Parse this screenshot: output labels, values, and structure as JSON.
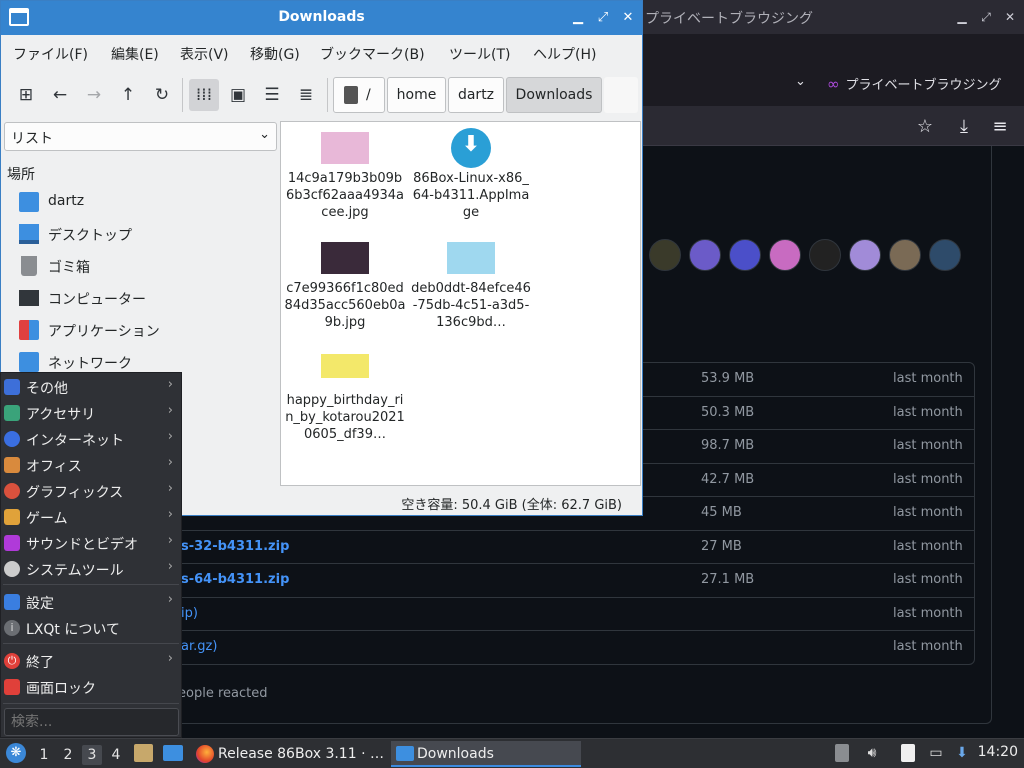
{
  "browser": {
    "title": "プライベートブラウジング",
    "private_tab_label": "プライベートブラウジング",
    "avatar_colors": [
      "#3a3a2a",
      "#6b5bc8",
      "#4b4fc9",
      "#c86bc1",
      "#222222",
      "#a18bd8",
      "#7a6a55",
      "#2e4b6a"
    ],
    "assets": [
      {
        "name": "",
        "size": "53.9 MB",
        "date": "last month"
      },
      {
        "name": "",
        "size": "50.3 MB",
        "date": "last month"
      },
      {
        "name": "",
        "size": "98.7 MB",
        "date": "last month"
      },
      {
        "name": "",
        "size": "42.7 MB",
        "date": "last month"
      },
      {
        "name": "",
        "size": "45 MB",
        "date": "last month"
      },
      {
        "name": "s-32-b4311.zip",
        "size": "27 MB",
        "date": "last month"
      },
      {
        "name": "s-64-b4311.zip",
        "size": "27.1 MB",
        "date": "last month"
      },
      {
        "name": "ip)",
        "size": "",
        "date": "last month"
      },
      {
        "name": "ar.gz)",
        "size": "",
        "date": "last month"
      }
    ],
    "reacted_text": "eople reacted"
  },
  "filemanager": {
    "title": "Downloads",
    "menu": [
      "ファイル(F)",
      "編集(E)",
      "表示(V)",
      "移動(G)",
      "ブックマーク(B)",
      "ツール(T)",
      "ヘルプ(H)"
    ],
    "breadcrumbs": [
      "/",
      "home",
      "dartz",
      "Downloads"
    ],
    "view_mode": "リスト",
    "places_heading": "場所",
    "places": [
      "dartz",
      "デスクトップ",
      "ゴミ箱",
      "コンピューター",
      "アプリケーション",
      "ネットワーク"
    ],
    "files": [
      {
        "name": "14c9a179b3b09b6b3cf62aaa4934acee.jpg",
        "thumb": "#e8b8d8"
      },
      {
        "name": "86Box-Linux-x86_64-b4311.AppImage",
        "thumb": "#2a9fd6"
      },
      {
        "name": "c7e99366f1c80ed84d35acc560eb0a9b.jpg",
        "thumb": "#3a2a3a"
      },
      {
        "name": "deb0ddt-84efce46-75db-4c51-a3d5-136c9bd…",
        "thumb": "#9fd8ef"
      },
      {
        "name": "happy_birthday_rin_by_kotarou20210605_df39…",
        "thumb": "#f3e86a"
      }
    ],
    "status": "空き容量: 50.4 GiB (全体: 62.7 GiB)"
  },
  "startmenu": {
    "categories": [
      {
        "label": "その他",
        "color": "#3d6fd9"
      },
      {
        "label": "アクセサリ",
        "color": "#3aa37a"
      },
      {
        "label": "インターネット",
        "color": "#3a6ee0"
      },
      {
        "label": "オフィス",
        "color": "#d98a3d"
      },
      {
        "label": "グラフィックス",
        "color": "#d9513d"
      },
      {
        "label": "ゲーム",
        "color": "#e0a23a"
      },
      {
        "label": "サウンドとビデオ",
        "color": "#b03ad9"
      },
      {
        "label": "システムツール",
        "color": "#cccccc"
      }
    ],
    "settings_label": "設定",
    "about_label": "LXQt について",
    "shutdown_label": "終了",
    "lock_label": "画面ロック",
    "search_placeholder": "検索..."
  },
  "taskbar": {
    "workspaces": [
      "1",
      "2",
      "3",
      "4"
    ],
    "tasks": [
      "Release 86Box 3.11 · …",
      "Downloads"
    ],
    "clock": "14:20"
  }
}
